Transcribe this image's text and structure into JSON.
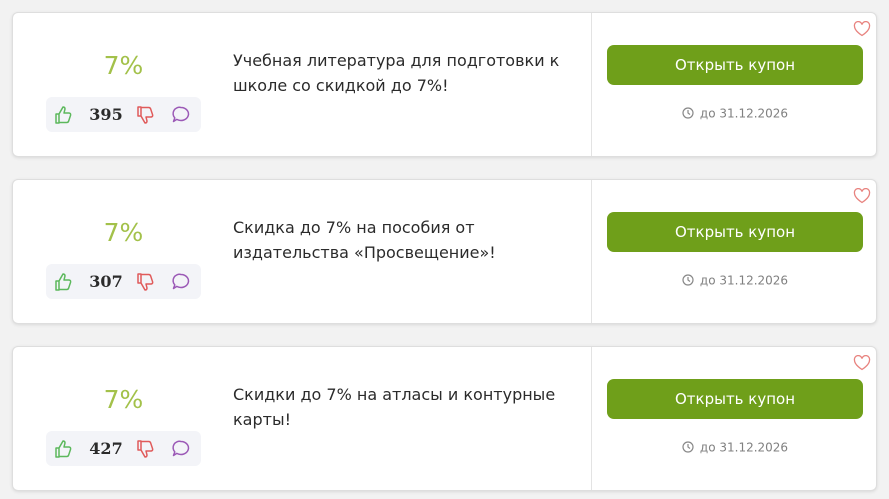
{
  "colors": {
    "discount": "#a3c14a",
    "button": "#6f9f1a",
    "thumb_up": "#5cb85c",
    "thumb_down": "#e05a5a",
    "comment": "#9b59b6",
    "heart": "#e8837f"
  },
  "icons": [
    "thumb-up-icon",
    "thumb-down-icon",
    "comment-icon",
    "clock-icon",
    "heart-icon"
  ],
  "coupons": [
    {
      "discount": "7%",
      "votes": "395",
      "title": "Учебная литература для подготовки к школе со скидкой до 7%!",
      "button_label": "Открыть купон",
      "expiry": "до 31.12.2026"
    },
    {
      "discount": "7%",
      "votes": "307",
      "title": "Скидка до 7% на пособия от издательства «Просвещение»!",
      "button_label": "Открыть купон",
      "expiry": "до 31.12.2026"
    },
    {
      "discount": "7%",
      "votes": "427",
      "title": "Скидки до 7% на атласы и контурные карты!",
      "button_label": "Открыть купон",
      "expiry": "до 31.12.2026"
    }
  ]
}
